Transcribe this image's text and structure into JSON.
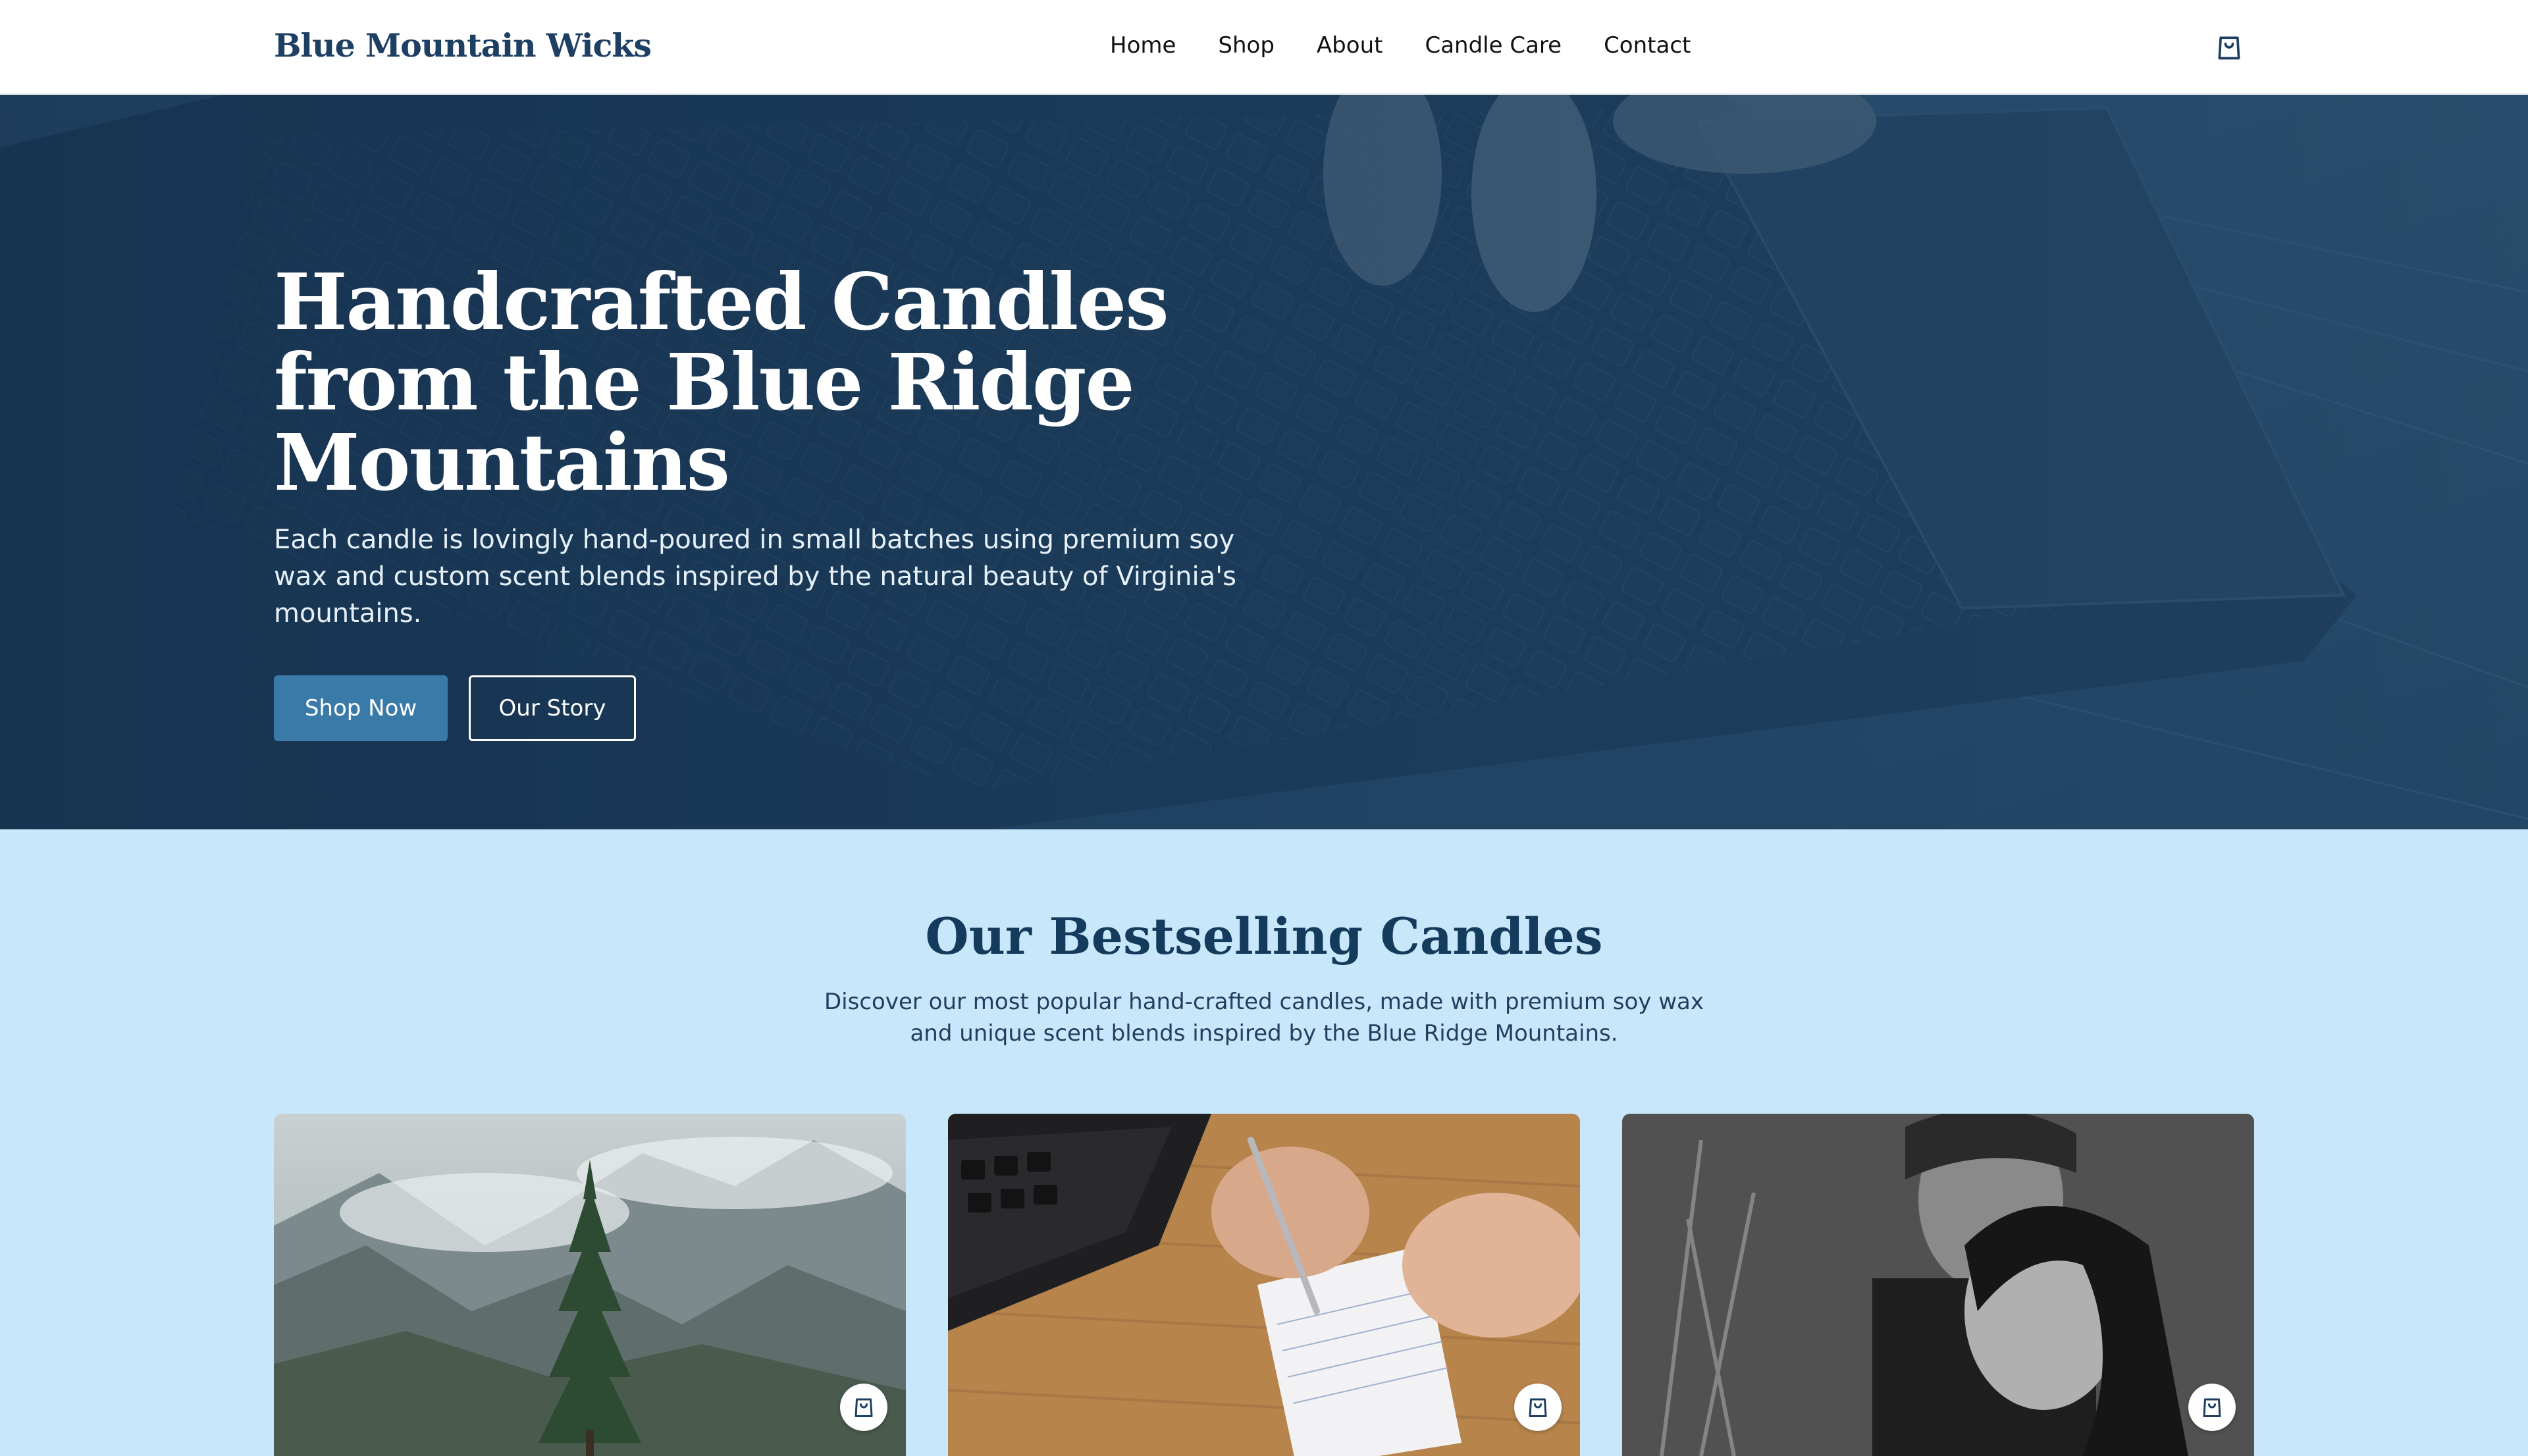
{
  "header": {
    "brand": "Blue Mountain Wicks",
    "nav": [
      "Home",
      "Shop",
      "About",
      "Candle Care",
      "Contact"
    ],
    "cart_icon": "shopping-bag-icon"
  },
  "hero": {
    "title": "Handcrafted Candles from the Blue Ridge Mountains",
    "subtitle": "Each candle is lovingly hand-poured in small batches using premium soy wax and custom scent blends inspired by the natural beauty of Virginia's mountains.",
    "primary_button": "Shop Now",
    "secondary_button": "Our Story"
  },
  "bestsellers": {
    "title": "Our Bestselling Candles",
    "subtitle": "Discover our most popular hand-crafted candles, made with premium soy wax and unique scent blends inspired by the Blue Ridge Mountains.",
    "products": [
      {
        "image": "misty mountains with pine tree",
        "cart_icon": "shopping-bag-icon"
      },
      {
        "image": "hands writing in notepad beside laptop",
        "cart_icon": "shopping-bag-icon"
      },
      {
        "image": "black and white portrait of couple",
        "cart_icon": "shopping-bag-icon"
      }
    ]
  },
  "colors": {
    "brand": "#1d3f63",
    "accent": "#3a7aa9",
    "section_background": "#c9e7fb",
    "hero_overlay": "#1f3f5e"
  }
}
